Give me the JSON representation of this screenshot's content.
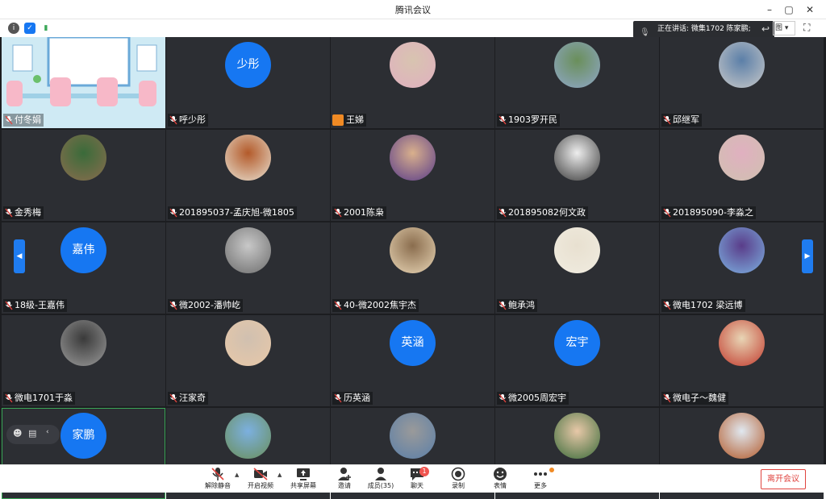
{
  "window": {
    "title": "腾讯会议"
  },
  "status_bar": {
    "speaking_text": "正在讲话: 微集1702 陈家鹏;",
    "view_label": "图"
  },
  "participants": [
    {
      "name": "付冬娟",
      "type": "image",
      "muted": true
    },
    {
      "name": "呼少彤",
      "type": "text",
      "initials": "少彤",
      "muted": true
    },
    {
      "name": "王娣",
      "type": "image",
      "muted": false,
      "host": true
    },
    {
      "name": "1903罗开民",
      "type": "image",
      "muted": true
    },
    {
      "name": "邱继军",
      "type": "image",
      "muted": true
    },
    {
      "name": "金秀梅",
      "type": "image",
      "muted": true
    },
    {
      "name": "201895037-孟庆旭-微1805",
      "type": "image",
      "muted": true
    },
    {
      "name": "2001陈枭",
      "type": "image",
      "muted": true
    },
    {
      "name": "201895082何文政",
      "type": "image",
      "muted": true
    },
    {
      "name": "201895090-李淼之",
      "type": "image",
      "muted": true
    },
    {
      "name": "18级-王嘉伟",
      "type": "text",
      "initials": "嘉伟",
      "muted": true
    },
    {
      "name": "微2002-潘帅屹",
      "type": "image",
      "muted": true
    },
    {
      "name": "40-微2002焦宇杰",
      "type": "image",
      "muted": true
    },
    {
      "name": "鲍承鸿",
      "type": "image",
      "muted": true
    },
    {
      "name": "微电1702 梁远博",
      "type": "image",
      "muted": true
    },
    {
      "name": "微电1701于淼",
      "type": "image",
      "muted": true
    },
    {
      "name": "汪家奇",
      "type": "image",
      "muted": true
    },
    {
      "name": "历英涵",
      "type": "text",
      "initials": "英涵",
      "muted": true
    },
    {
      "name": "微2005周宏宇",
      "type": "text",
      "initials": "宏宇",
      "muted": true
    },
    {
      "name": "微电子～魏健",
      "type": "image",
      "muted": true
    },
    {
      "name": "",
      "type": "text",
      "initials": "家鹏",
      "muted": true,
      "active": true
    },
    {
      "name": "",
      "type": "image",
      "muted": true
    },
    {
      "name": "",
      "type": "image",
      "muted": true
    },
    {
      "name": "",
      "type": "image",
      "muted": true
    },
    {
      "name": "",
      "type": "image",
      "muted": true
    }
  ],
  "toolbar": {
    "unmute": "解除静音",
    "start_video": "开启视频",
    "share_screen": "共享屏幕",
    "invite": "邀请",
    "members": "成员(35)",
    "chat": "聊天",
    "chat_badge": "1",
    "record": "录制",
    "reactions": "表情",
    "more": "更多",
    "leave": "离开会议"
  },
  "colors": {
    "accent": "#1677f2",
    "leave": "#e0443f",
    "tile_bg": "#2c2e33",
    "grid_bg": "#1c1d20"
  }
}
